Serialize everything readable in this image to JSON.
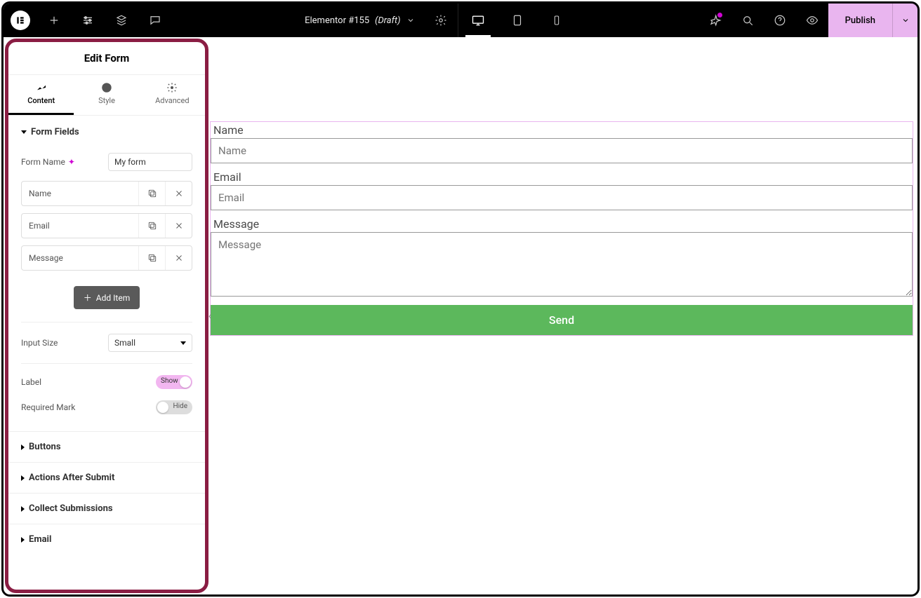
{
  "topbar": {
    "doc_name": "Elementor #155",
    "doc_status": "(Draft)",
    "publish": "Publish"
  },
  "panel": {
    "title": "Edit Form",
    "tabs": {
      "content": "Content",
      "style": "Style",
      "advanced": "Advanced"
    },
    "sections": {
      "form_fields": "Form Fields",
      "buttons": "Buttons",
      "actions": "Actions After Submit",
      "collect": "Collect Submissions",
      "email": "Email"
    },
    "form_name_label": "Form Name",
    "form_name_value": "My form",
    "fields": [
      {
        "label": "Name"
      },
      {
        "label": "Email"
      },
      {
        "label": "Message"
      }
    ],
    "add_item": "Add Item",
    "input_size_label": "Input Size",
    "input_size_value": "Small",
    "label_label": "Label",
    "label_toggle": "Show",
    "required_label": "Required Mark",
    "required_toggle": "Hide"
  },
  "canvas": {
    "fields": [
      {
        "label": "Name",
        "placeholder": "Name",
        "type": "text"
      },
      {
        "label": "Email",
        "placeholder": "Email",
        "type": "text"
      },
      {
        "label": "Message",
        "placeholder": "Message",
        "type": "area"
      }
    ],
    "submit": "Send"
  }
}
